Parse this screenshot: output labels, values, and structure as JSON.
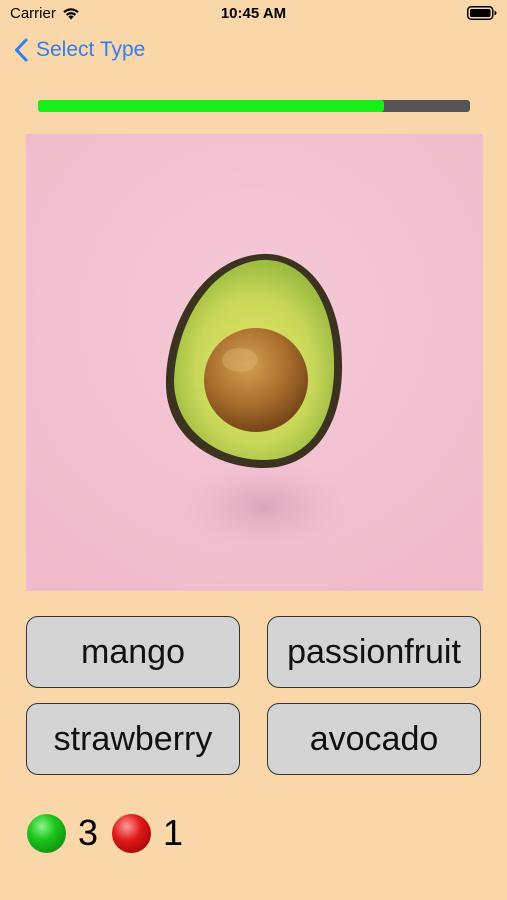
{
  "status_bar": {
    "carrier": "Carrier",
    "time": "10:45 AM"
  },
  "nav": {
    "back_label": "Select Type"
  },
  "progress": {
    "fraction": 0.8
  },
  "photo": {
    "icon": "avocado-photo",
    "background_color": "#f3c1d2"
  },
  "answers": [
    {
      "label": "mango"
    },
    {
      "label": "passionfruit"
    },
    {
      "label": "strawberry"
    },
    {
      "label": "avocado"
    }
  ],
  "score": {
    "correct": "3",
    "wrong": "1"
  },
  "colors": {
    "background": "#fad7a8",
    "accent": "#2f7ff2",
    "progress_fill": "#18ef18",
    "progress_track": "#555555",
    "button_bg": "#d4d4d4"
  }
}
